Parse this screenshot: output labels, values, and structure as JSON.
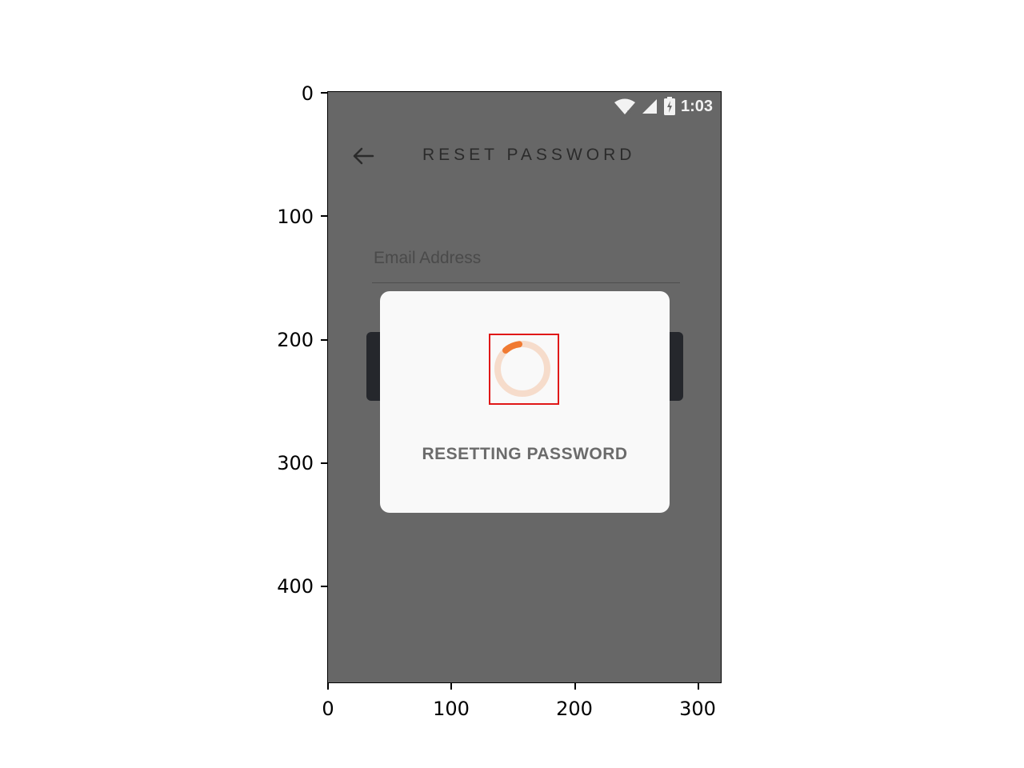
{
  "status_bar": {
    "time": "1:03",
    "icons": [
      "wifi-off-icon",
      "signal-icon",
      "battery-charging-icon"
    ]
  },
  "toolbar": {
    "back_icon": "arrow-left-icon",
    "title": "RESET PASSWORD"
  },
  "form": {
    "email_placeholder": "Email Address",
    "email_value": ""
  },
  "dialog": {
    "message": "RESETTING PASSWORD",
    "spinner_icon": "loading-spinner-icon"
  },
  "axes": {
    "y_ticks": [
      "0",
      "100",
      "200",
      "300",
      "400"
    ],
    "x_ticks": [
      "0",
      "100",
      "200",
      "300"
    ]
  },
  "colors": {
    "overlay": "#676767",
    "dialog_bg": "#f9f9f9",
    "accent": "#f07a32",
    "button_dark": "#25272c",
    "highlight": "#e01818"
  }
}
